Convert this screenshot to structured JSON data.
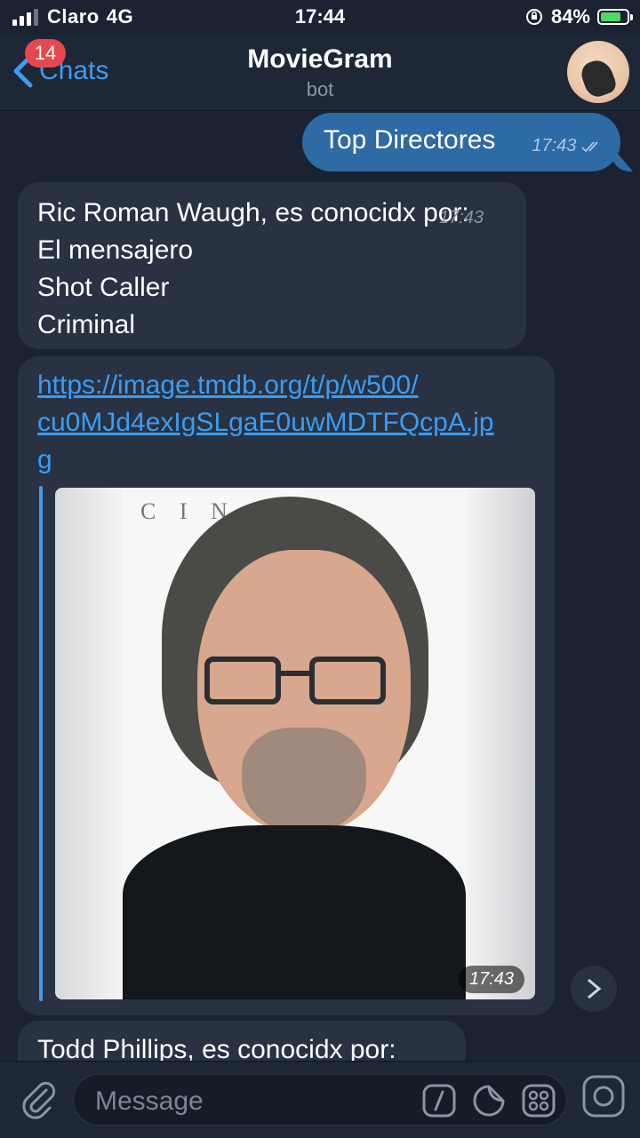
{
  "status_bar": {
    "carrier": "Claro",
    "network": "4G",
    "time": "17:44",
    "battery_percent": "84%",
    "battery_level": 0.84,
    "signal_bars_total": 4,
    "signal_bars_active": 3
  },
  "header": {
    "back_label": "Chats",
    "unread_badge": "14",
    "title": "MovieGram",
    "subtitle": "bot"
  },
  "messages": {
    "outgoing": {
      "text": "Top Directores",
      "time": "17:43"
    },
    "director1": {
      "lines": [
        "Ric Roman Waugh, es conocidx por:",
        "El mensajero",
        "Shot Caller",
        "Criminal"
      ],
      "time": "17:43"
    },
    "link_message": {
      "link_line1": "https://image.tmdb.org/t/p/w500/",
      "link_line2": "cu0MJd4exIgSLgaE0uwMDTFQcpA.jp",
      "link_line3": "g",
      "photo_watermark": "C I N E",
      "time": "17:43"
    },
    "director2": {
      "first_line": "Todd Phillips, es conocidx por:"
    }
  },
  "input_bar": {
    "placeholder": "Message"
  },
  "colors": {
    "background": "#1b2332",
    "outgoing_bubble": "#2e6aa3",
    "incoming_bubble": "#283243",
    "accent": "#3b9cf2",
    "badge": "#e5484d"
  },
  "icons": [
    "signal-icon",
    "battery-icon",
    "rotation-lock-icon",
    "back-chevron-icon",
    "double-check-icon",
    "paperclip-icon",
    "slash-command-icon",
    "sticker-icon",
    "bot-menu-icon",
    "camera-icon",
    "share-icon",
    "chevron-down-icon"
  ]
}
